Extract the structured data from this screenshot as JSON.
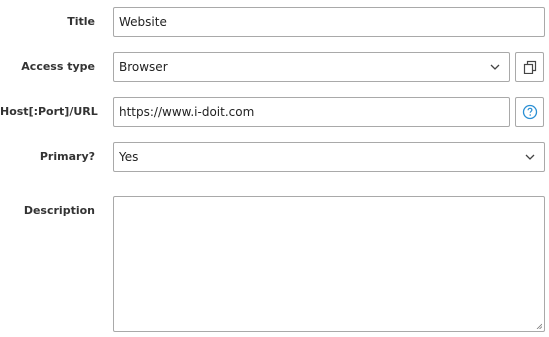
{
  "fields": {
    "title": {
      "label": "Title",
      "value": "Website"
    },
    "access_type": {
      "label": "Access type",
      "value": "Browser"
    },
    "host": {
      "label": "Host[:Port]/URL",
      "value": "https://www.i-doit.com"
    },
    "primary": {
      "label": "Primary?",
      "value": "Yes"
    },
    "description": {
      "label": "Description",
      "value": ""
    }
  },
  "icons": {
    "access_type_side": "copy-icon",
    "host_side": "help-circle-icon",
    "dropdown": "chevron-down-icon",
    "resize": "resize-grip-icon"
  },
  "colors": {
    "border": "#a9a9a9",
    "help_accent": "#2a8fd4"
  }
}
